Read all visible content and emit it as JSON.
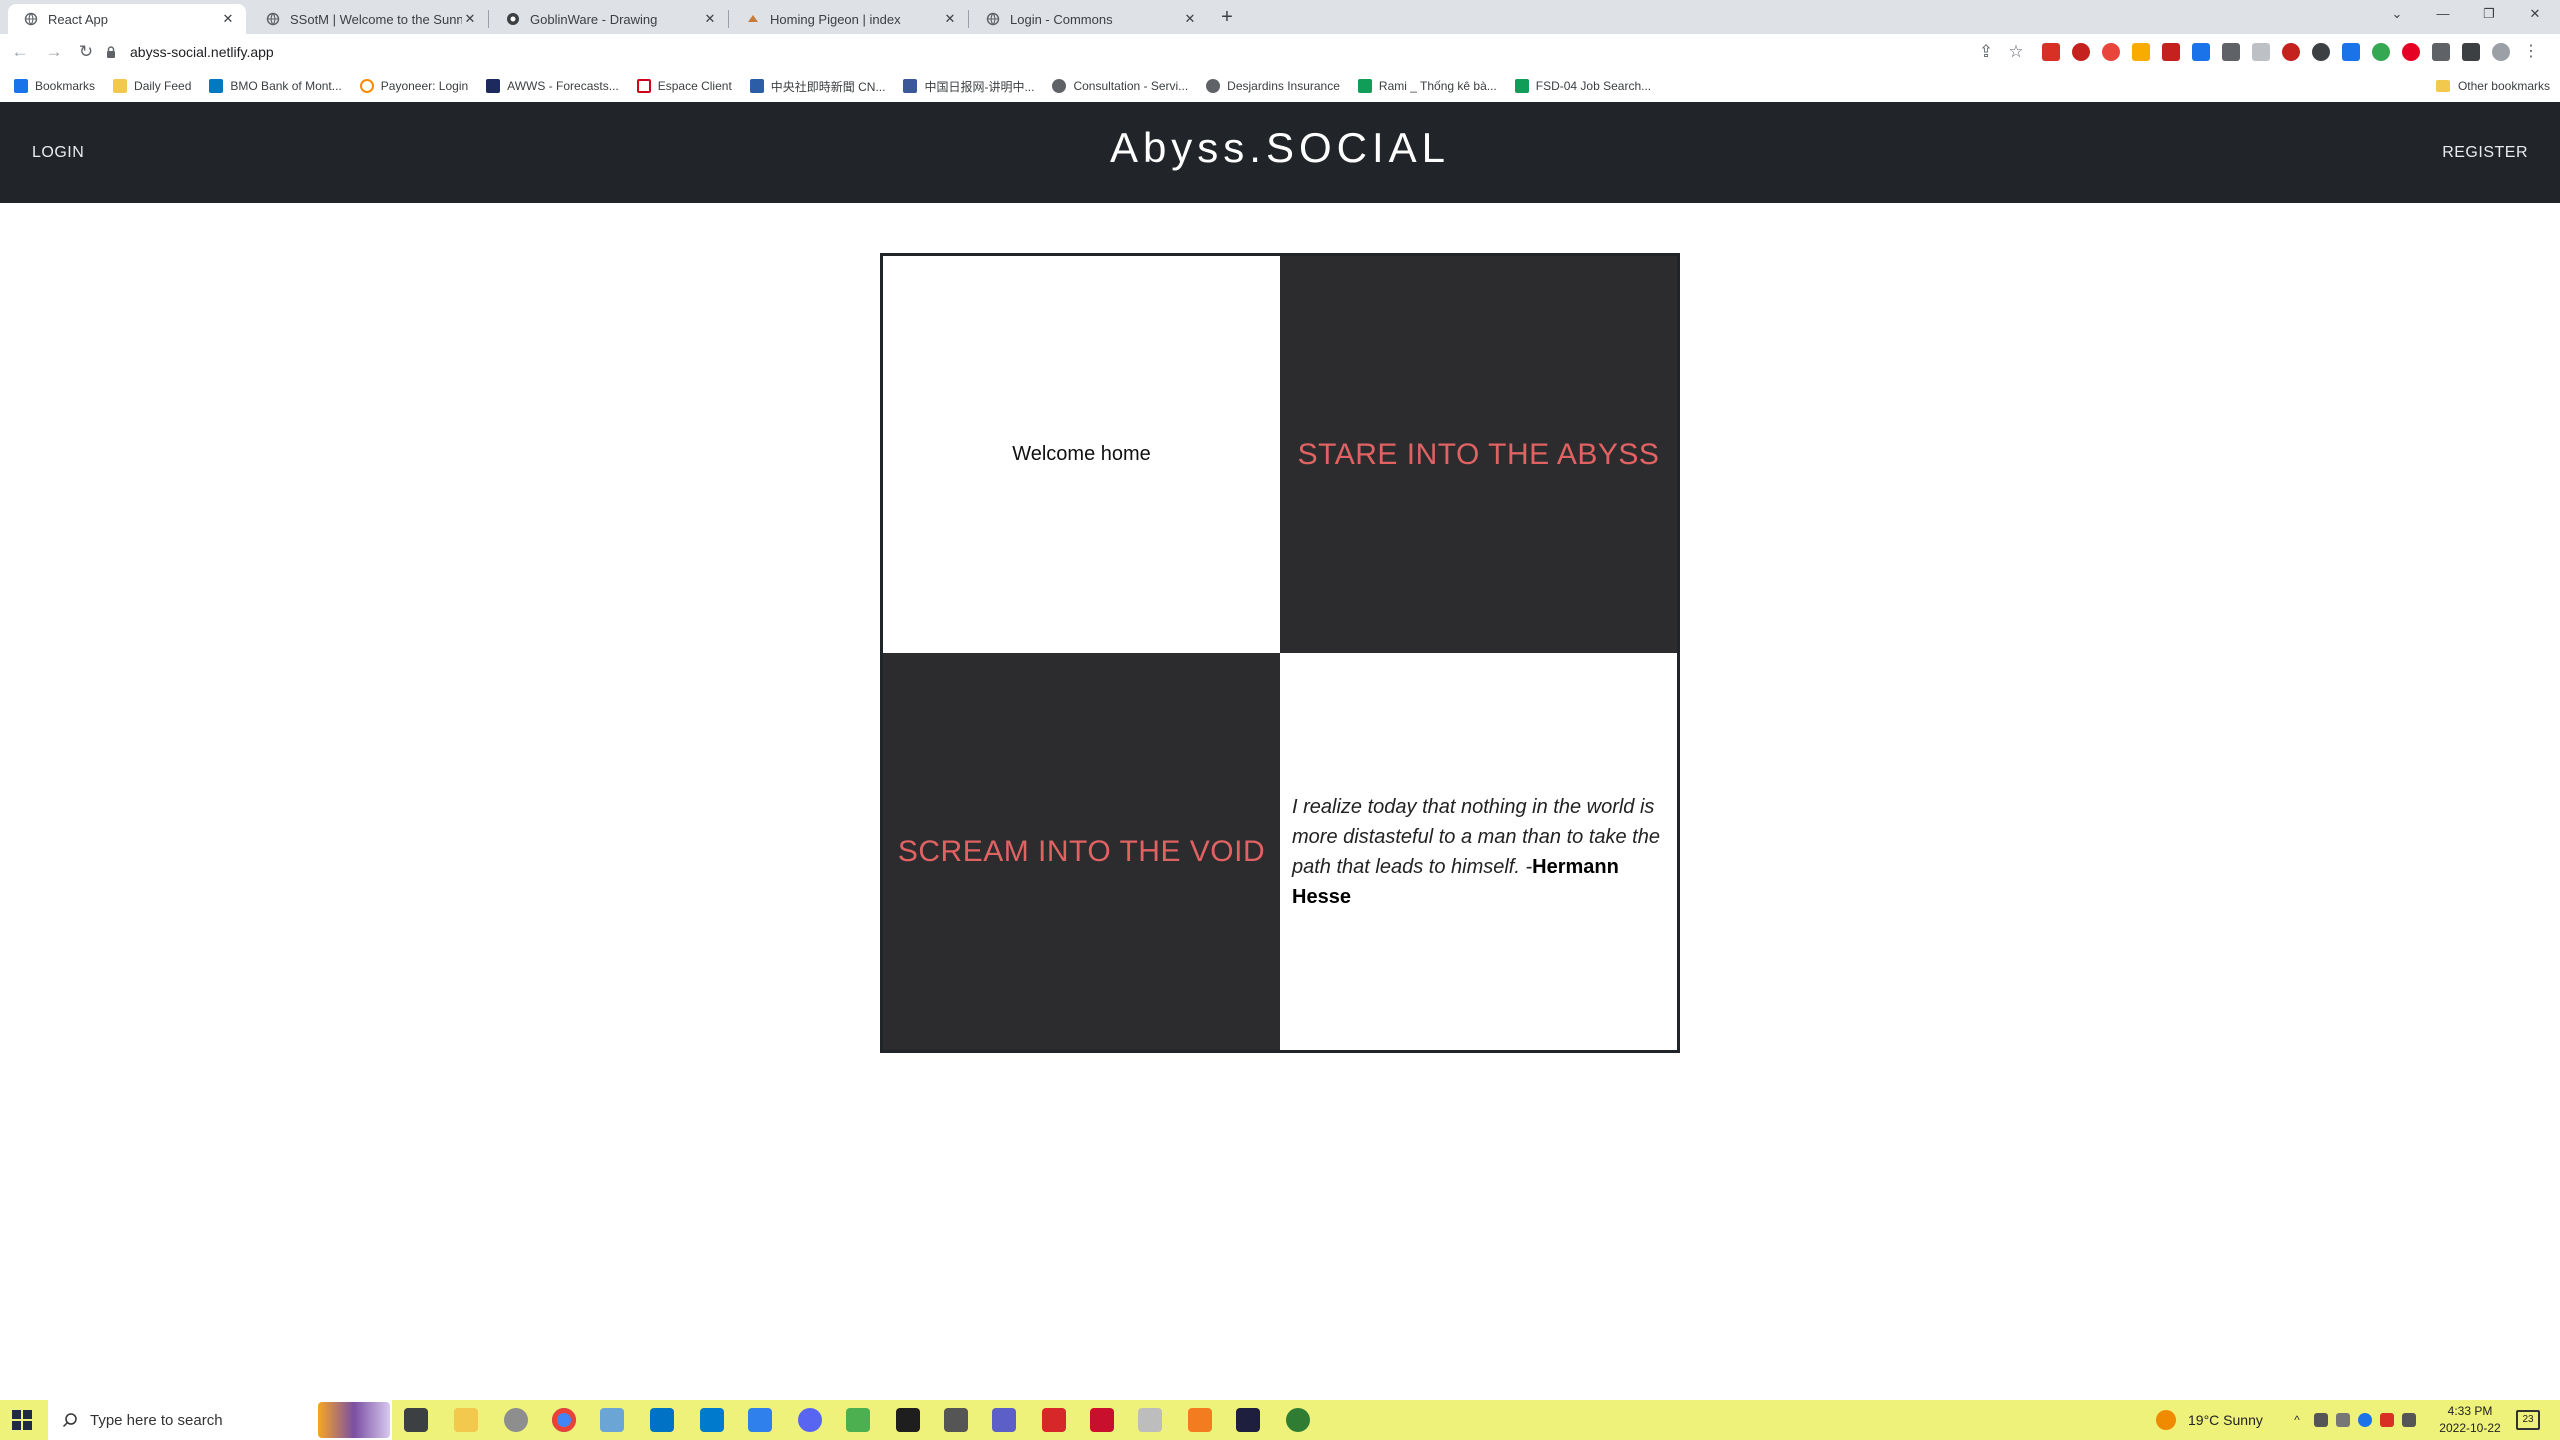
{
  "browser": {
    "tabs": [
      {
        "title": "React App",
        "active": true
      },
      {
        "title": "SSotM | Welcome to the Sunny S",
        "active": false
      },
      {
        "title": "GoblinWare - Drawing",
        "active": false
      },
      {
        "title": "Homing Pigeon | index",
        "active": false
      },
      {
        "title": "Login - Commons",
        "active": false
      }
    ],
    "new_tab_label": "+",
    "url": "abyss-social.netlify.app",
    "bookmarks": [
      {
        "label": "Bookmarks",
        "color": "#1a73e8"
      },
      {
        "label": "Daily Feed",
        "color": "#f2c94c"
      },
      {
        "label": "BMO Bank of Mont...",
        "color": "#0079c1"
      },
      {
        "label": "Payoneer: Login",
        "color": "#ff8a00"
      },
      {
        "label": "AWWS - Forecasts...",
        "color": "#1c2a5e"
      },
      {
        "label": "Espace Client",
        "color": "#d0021b"
      },
      {
        "label": "中央社即時新聞 CN...",
        "color": "#2b5ea7"
      },
      {
        "label": "中国日报网-讲明中...",
        "color": "#3b5998"
      },
      {
        "label": "Consultation - Servi...",
        "color": "#5f6368"
      },
      {
        "label": "Desjardins Insurance",
        "color": "#5f6368"
      },
      {
        "label": "Rami _ Thống kê bà...",
        "color": "#0f9d58"
      },
      {
        "label": "FSD-04 Job Search...",
        "color": "#0f9d58"
      }
    ],
    "other_bookmarks": "Other bookmarks"
  },
  "site": {
    "login_label": "LOGIN",
    "register_label": "REGISTER",
    "title": "Abyss.SOCIAL",
    "welcome": "Welcome home",
    "stare": "STARE INTO THE ABYSS",
    "scream": "SCREAM INTO THE VOID",
    "quote_text": "I realize today that nothing in the world is more distasteful to a man than to take the path that leads to himself. -",
    "quote_author": "Hermann Hesse",
    "accent_color": "#e06262",
    "header_color": "#212529",
    "dark_cell_color": "#2c2c2e"
  },
  "taskbar": {
    "search_placeholder": "Type here to search",
    "weather": "19°C  Sunny",
    "time": "4:33 PM",
    "date": "2022-10-22",
    "notifications": "23"
  }
}
